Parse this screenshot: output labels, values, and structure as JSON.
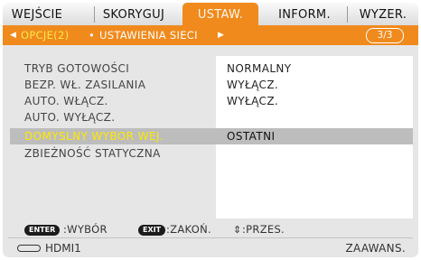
{
  "tabs": [
    {
      "label": "WEJŚCIE"
    },
    {
      "label": "SKORYGUJ"
    },
    {
      "label": "USTAW."
    },
    {
      "label": "INFORM."
    },
    {
      "label": "WYZER."
    }
  ],
  "subtabs": {
    "left_arrow": "◀",
    "active": "OPCJE(2)",
    "separator": "•",
    "inactive": "USTAWIENIA SIECI",
    "right_arrow": "▶",
    "page": "3/3"
  },
  "menu": {
    "rows": [
      {
        "label": "TRYB GOTOWOŚCI",
        "value": "NORMALNY"
      },
      {
        "label": "BEZP. WŁ. ZASILANIA",
        "value": "WYŁĄCZ."
      },
      {
        "label": "AUTO. WŁĄCZ.",
        "value": "WYŁĄCZ."
      },
      {
        "label": "AUTO. WYŁĄCZ.",
        "value": ""
      },
      {
        "label": "DOMYSLNY WYBOR WEJ.",
        "value": "OSTATNI"
      },
      {
        "label": "ZBIEŻNOŚĆ STATYCZNA",
        "value": ""
      }
    ],
    "selected_index": 4
  },
  "footer": {
    "enter_key": "ENTER",
    "enter_text": ":WYBÓR",
    "exit_key": "EXIT",
    "exit_text": ":ZAKOŃ.",
    "move_symbol": "⇕",
    "move_text": ":PRZES.",
    "source_icon": "hdmi-connector-icon",
    "source": "HDMI1",
    "level": "ZAAWANS."
  },
  "colors": {
    "accent": "#f08a1c",
    "selected_text": "#ffe800",
    "background": "#e6e6e6"
  }
}
